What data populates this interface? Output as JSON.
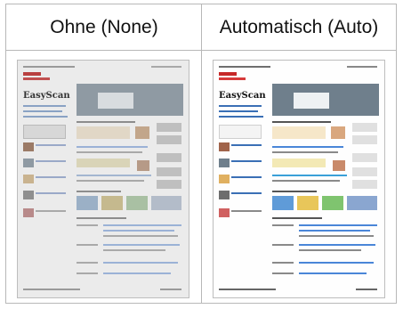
{
  "columns": {
    "left": "Ohne (None)",
    "right": "Automatisch (Auto)"
  },
  "preview": {
    "logo_text": "EasyScan"
  },
  "colors": {
    "border": "#b8b8b8",
    "page_dull": "#ebebeb",
    "page_clean": "#fefefe",
    "accent_red": "#c62828",
    "accent_blue": "#3a6fb5"
  }
}
